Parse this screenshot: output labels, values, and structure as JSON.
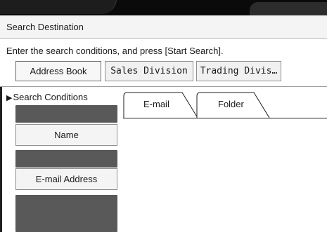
{
  "window": {
    "title": "Search Destination"
  },
  "instruction": "Enter the search conditions, and press [Start Search].",
  "sources": [
    {
      "label": "Address Book",
      "active": true
    },
    {
      "label": "Sales Division",
      "active": false
    },
    {
      "label": "Trading Divis…",
      "active": false
    }
  ],
  "search_conditions": {
    "label": "Search Conditions",
    "fields": [
      {
        "button_label": "Name"
      },
      {
        "button_label": "E-mail Address"
      }
    ]
  },
  "tabs": [
    {
      "label": "E-mail",
      "active": true
    },
    {
      "label": "Folder",
      "active": false
    }
  ],
  "colors": {
    "dark_field": "#595959",
    "button_bg": "#f1f1f1",
    "top_bar": "#0a0a0a"
  }
}
